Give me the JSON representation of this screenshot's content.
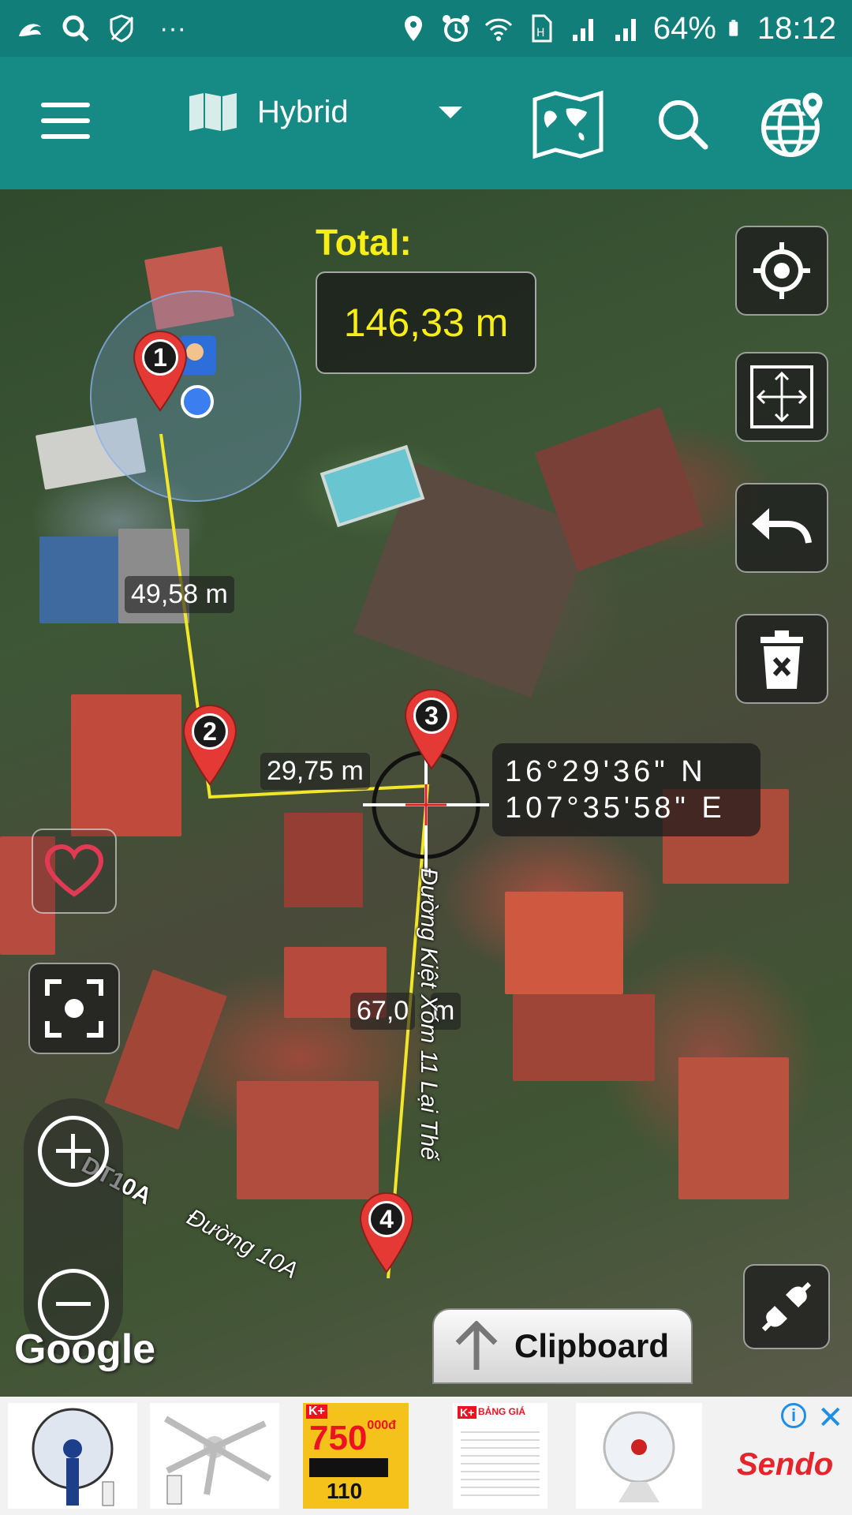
{
  "status_bar": {
    "battery": "64%",
    "time": "18:12",
    "dots": "···",
    "icons": [
      "uc-browser-icon",
      "search-icon",
      "shield-icon",
      "location-icon",
      "alarm-icon",
      "wifi-icon",
      "sim-icon",
      "signal-icon",
      "signal-icon",
      "battery-icon"
    ]
  },
  "app_bar": {
    "map_type": "Hybrid",
    "icons": [
      "menu-icon",
      "map-type-icon",
      "dropdown-icon",
      "world-map-icon",
      "search-icon",
      "globe-location-icon"
    ]
  },
  "measurement": {
    "total_label": "Total:",
    "total_value": "146,33 m",
    "segments": [
      "49,58 m",
      "29,75 m",
      "67,0",
      "m"
    ],
    "points": [
      "1",
      "2",
      "3",
      "4"
    ]
  },
  "crosshair": {
    "latitude": "16°29'36\" N",
    "longitude": "107°35'58\" E"
  },
  "map": {
    "road_labels": [
      "Đường Kiệt Xóm 11 Lại Thế",
      "DT10A",
      "Đường 10A"
    ],
    "attribution": "Google"
  },
  "controls": {
    "clipboard_label": "Clipboard",
    "icons": [
      "my-location-icon",
      "fit-bounds-icon",
      "undo-icon",
      "delete-icon",
      "favorite-icon",
      "screenshot-icon",
      "zoom-in-icon",
      "zoom-out-icon",
      "unplug-icon",
      "arrow-up-icon"
    ]
  },
  "ad": {
    "brand": "Sendo",
    "info": "i",
    "close": "✕",
    "tv_price": "750",
    "tv_price_unit": "000đ",
    "tv_small": "110",
    "tv_banner": "BẢNG GIÁ",
    "kplus": "K+"
  },
  "colors": {
    "app_bar": "#168b86",
    "status_bar": "#117e7a",
    "total_text": "#f7ee16",
    "route_line": "#f2e629",
    "pin": "#e53935"
  }
}
